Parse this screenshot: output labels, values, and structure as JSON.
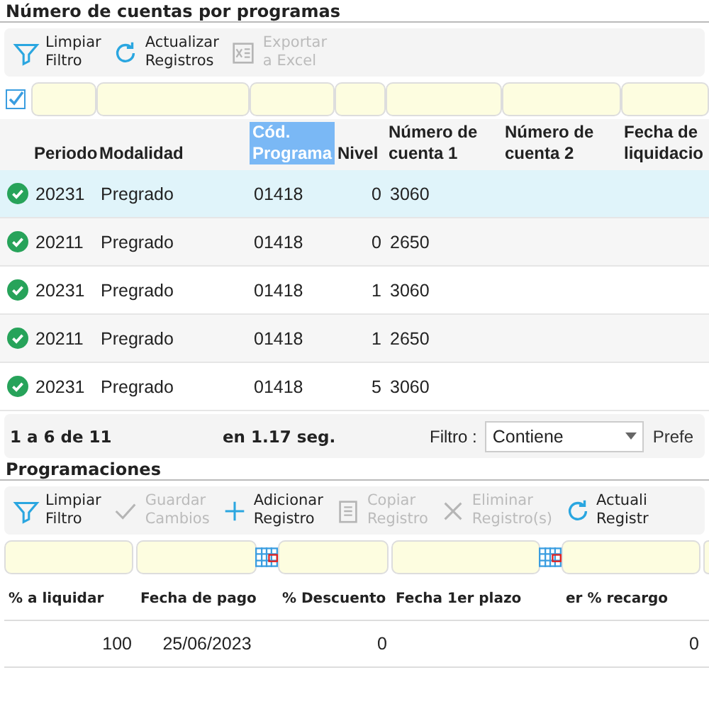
{
  "sections": [
    {
      "title": "Número de cuentas por programas",
      "toolbar": [
        {
          "kind": "filter",
          "label": "Limpiar\nFiltro",
          "disabled": false
        },
        {
          "kind": "refresh",
          "label": "Actualizar\nRegistros",
          "disabled": false
        },
        {
          "kind": "excel",
          "label": "Exportar\na Excel",
          "disabled": true
        }
      ],
      "select_all": {
        "checked": true
      },
      "columns": [
        {
          "label": "Periodo",
          "highlighted": false
        },
        {
          "label": "Modalidad",
          "highlighted": false
        },
        {
          "label": "Cód.\nPrograma",
          "highlighted": true
        },
        {
          "label": "Nivel",
          "highlighted": false
        },
        {
          "label": "Número de\ncuenta 1",
          "highlighted": false
        },
        {
          "label": "Número de\ncuenta 2",
          "highlighted": false
        },
        {
          "label": "Fecha de\nliquidacio",
          "highlighted": false
        }
      ],
      "rows": [
        {
          "selected": true,
          "active": true,
          "cells": [
            "20231",
            "Pregrado",
            "01418",
            "0",
            "3060",
            "",
            ""
          ]
        },
        {
          "selected": false,
          "active": true,
          "cells": [
            "20211",
            "Pregrado",
            "01418",
            "0",
            "2650",
            "",
            ""
          ]
        },
        {
          "selected": false,
          "active": true,
          "cells": [
            "20231",
            "Pregrado",
            "01418",
            "1",
            "3060",
            "",
            ""
          ]
        },
        {
          "selected": false,
          "active": true,
          "cells": [
            "20211",
            "Pregrado",
            "01418",
            "1",
            "2650",
            "",
            ""
          ]
        },
        {
          "selected": false,
          "active": true,
          "cells": [
            "20231",
            "Pregrado",
            "01418",
            "5",
            "3060",
            "",
            ""
          ]
        }
      ],
      "pager": {
        "range": "1 a 6 de 11",
        "time": "en 1.17 seg.",
        "filter_label": "Filtro :",
        "filter_value": "Contiene",
        "next_label": "Prefe"
      }
    },
    {
      "title": "Programaciones",
      "toolbar": [
        {
          "kind": "filter",
          "label": "Limpiar\nFiltro",
          "disabled": false
        },
        {
          "kind": "check",
          "label": "Guardar\nCambios",
          "disabled": true
        },
        {
          "kind": "plus",
          "label": "Adicionar\nRegistro",
          "disabled": false
        },
        {
          "kind": "copy",
          "label": "Copiar\nRegistro",
          "disabled": true
        },
        {
          "kind": "x",
          "label": "Eliminar\nRegistro(s)",
          "disabled": true
        },
        {
          "kind": "refresh",
          "label": "Actuali\nRegistr",
          "disabled": false
        }
      ],
      "columns": [
        {
          "label": "% a liquidar",
          "kind": "number"
        },
        {
          "label": "Fecha de pago",
          "kind": "date"
        },
        {
          "label": "% Descuento",
          "kind": "number"
        },
        {
          "label": "Fecha 1er plazo",
          "kind": "date"
        },
        {
          "label": "er % recargo",
          "kind": "number"
        }
      ],
      "rows": [
        {
          "selected": false,
          "cells": [
            "100",
            "25/06/2023",
            "0",
            "",
            "0"
          ]
        }
      ]
    }
  ]
}
